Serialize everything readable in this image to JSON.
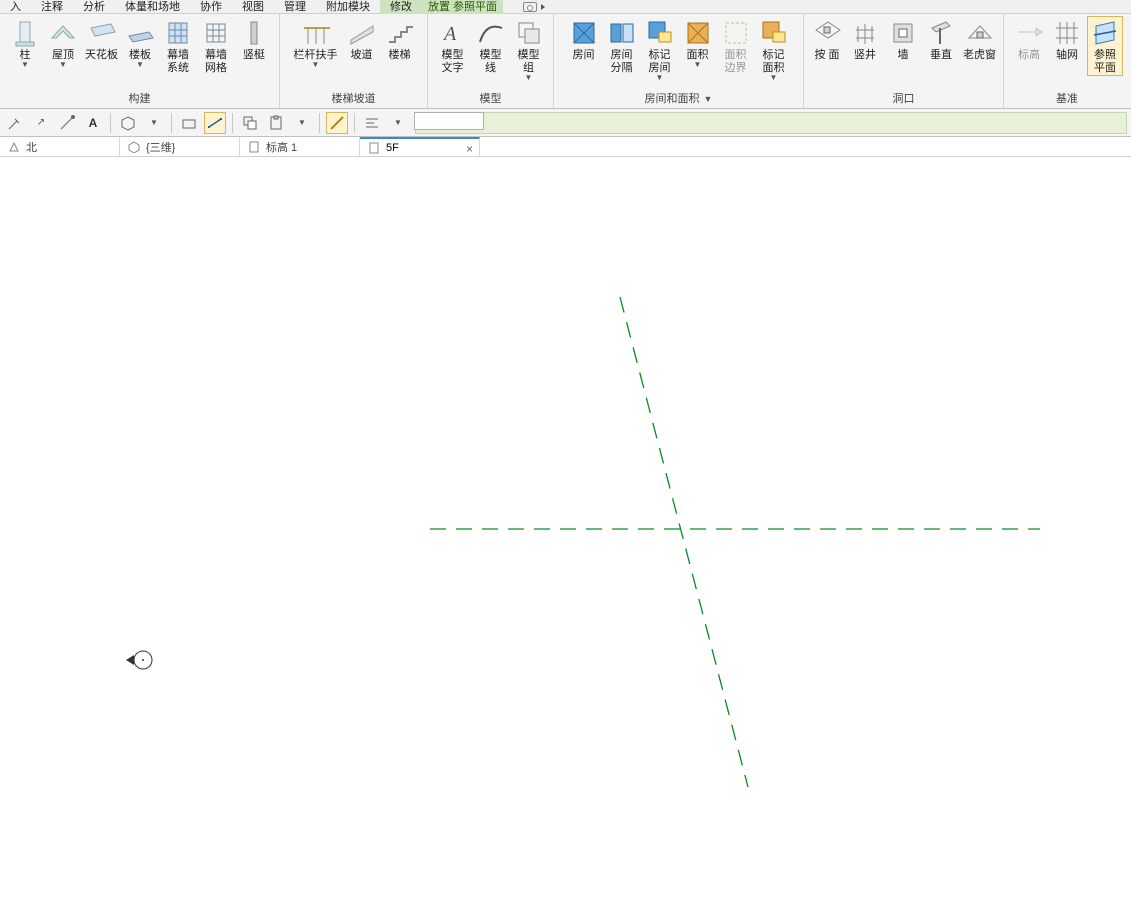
{
  "menu": {
    "items": [
      "入",
      "注释",
      "分析",
      "体量和场地",
      "协作",
      "视图",
      "管理",
      "附加模块"
    ],
    "modify": "修改",
    "context_tab": "放置 参照平面"
  },
  "ribbon": {
    "panels": {
      "build": {
        "title": "构建",
        "items": [
          {
            "label": "柱",
            "drop": true
          },
          {
            "label": "屋顶",
            "drop": true
          },
          {
            "label": "天花板"
          },
          {
            "label": "楼板",
            "drop": true
          },
          {
            "label": "幕墙\n系统"
          },
          {
            "label": "幕墙\n网格"
          },
          {
            "label": "竖梃"
          }
        ]
      },
      "stairs": {
        "title": "楼梯坡道",
        "items": [
          {
            "label": "栏杆扶手",
            "drop": true
          },
          {
            "label": "坡道"
          },
          {
            "label": "楼梯"
          }
        ]
      },
      "model": {
        "title": "模型",
        "items": [
          {
            "label": "模型\n文字"
          },
          {
            "label": "模型\n线"
          },
          {
            "label": "模型\n组",
            "drop": true
          }
        ]
      },
      "room": {
        "title": "房间和面积",
        "expand": true,
        "items": [
          {
            "label": "房间"
          },
          {
            "label": "房间\n分隔"
          },
          {
            "label": "标记\n房间",
            "drop": true
          },
          {
            "label": "面积",
            "drop": true
          },
          {
            "label": "面积\n边界",
            "disabled": true
          },
          {
            "label": "标记\n面积",
            "drop": true
          }
        ]
      },
      "opening": {
        "title": "洞口",
        "items": [
          {
            "label": "按\n面"
          },
          {
            "label": "竖井"
          },
          {
            "label": "墙"
          },
          {
            "label": "垂直"
          },
          {
            "label": "老虎窗"
          }
        ]
      },
      "datum": {
        "title": "基准",
        "items": [
          {
            "label": "标高",
            "disabled": true
          },
          {
            "label": "轴网"
          },
          {
            "label": "参照\n平面",
            "active": true
          }
        ]
      }
    }
  },
  "options": {
    "offset_value": ""
  },
  "tabs": {
    "items": [
      {
        "label": "北",
        "icon": "home"
      },
      {
        "label": "{三维}",
        "icon": "cube"
      },
      {
        "label": "标高 1",
        "icon": "sheet"
      },
      {
        "label": "5F",
        "icon": "sheet",
        "active": true,
        "closeable": true
      }
    ]
  }
}
